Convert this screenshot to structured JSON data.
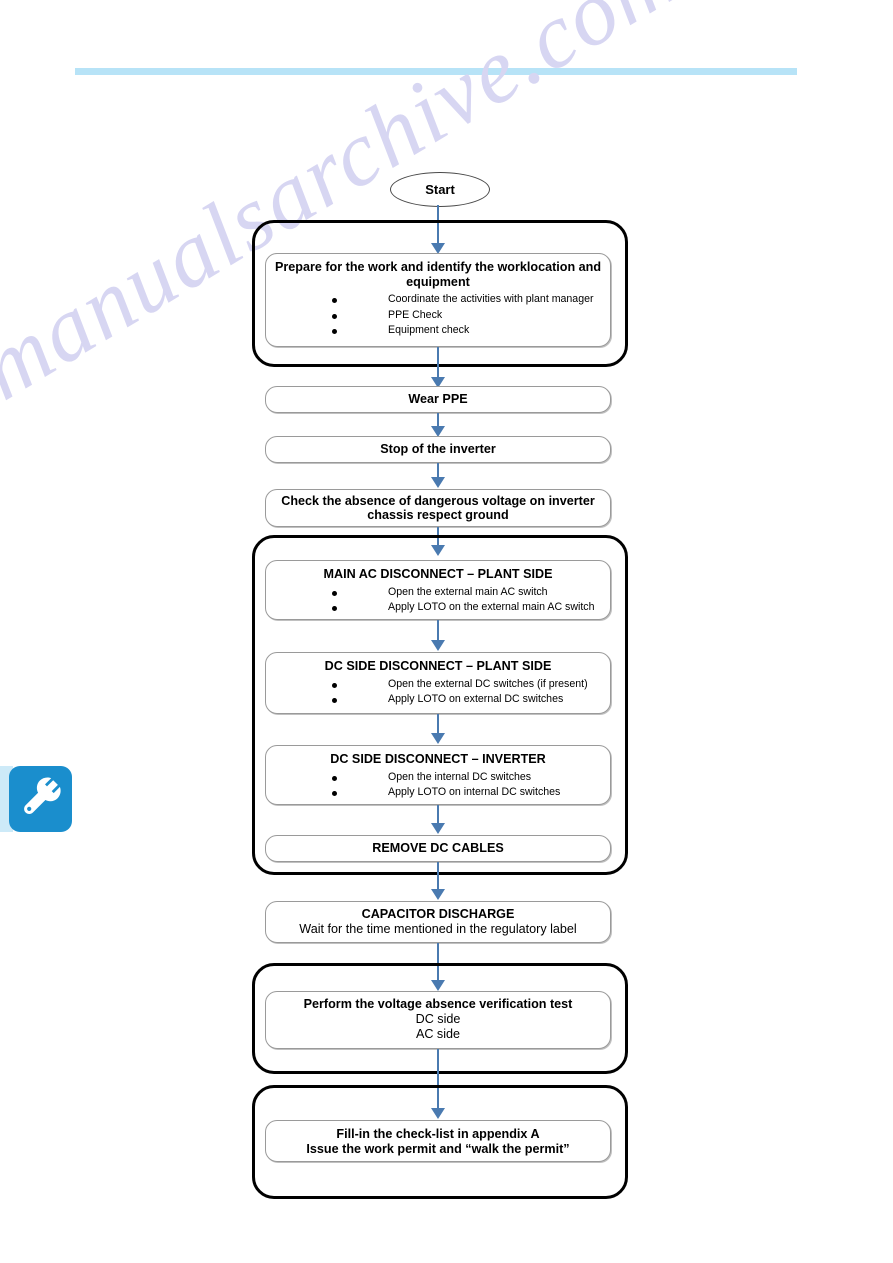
{
  "page": {
    "rule_color": "#b7e3f7",
    "watermark_text": "manualsarchive.com"
  },
  "side_tab": {
    "icon": "wrench-icon",
    "background_color": "#1a8ecd",
    "strip_color": "#cdeaf8"
  },
  "flowchart": {
    "type": "flowchart",
    "accent_arrow_color": "#4a7ab0",
    "start_label": "Start",
    "nodes": [
      {
        "id": "prepare",
        "title": "Prepare for the work and identify the worklocation and equipment",
        "bullets": [
          "Coordinate the activities with plant manager",
          "PPE Check",
          "Equipment check"
        ]
      },
      {
        "id": "wear-ppe",
        "title": "Wear PPE"
      },
      {
        "id": "stop-inverter",
        "title": "Stop of the inverter"
      },
      {
        "id": "check-absence",
        "title": "Check the absence of dangerous voltage on inverter chassis respect ground"
      },
      {
        "id": "main-ac-disconnect",
        "title": "MAIN AC DISCONNECT – PLANT SIDE",
        "bullets": [
          "Open the external main AC switch",
          "Apply LOTO on the external main AC switch"
        ]
      },
      {
        "id": "dc-disconnect-plant",
        "title": "DC SIDE DISCONNECT – PLANT SIDE",
        "bullets": [
          "Open the external DC switches (if present)",
          "Apply LOTO on external DC switches"
        ]
      },
      {
        "id": "dc-disconnect-inverter",
        "title": "DC SIDE DISCONNECT – INVERTER",
        "bullets": [
          "Open the internal DC switches",
          "Apply LOTO on internal DC switches"
        ]
      },
      {
        "id": "remove-dc-cables",
        "title": "REMOVE DC CABLES"
      },
      {
        "id": "capacitor-discharge",
        "title": "CAPACITOR DISCHARGE",
        "sub": "Wait for the time mentioned in the regulatory label"
      },
      {
        "id": "voltage-absence-test",
        "title": "Perform the voltage absence verification test",
        "sub_lines": [
          "DC side",
          "AC side"
        ]
      },
      {
        "id": "fill-checklist",
        "title_lines": [
          "Fill-in the check-list in appendix A",
          "Issue the work permit and “walk the permit”"
        ]
      }
    ]
  }
}
